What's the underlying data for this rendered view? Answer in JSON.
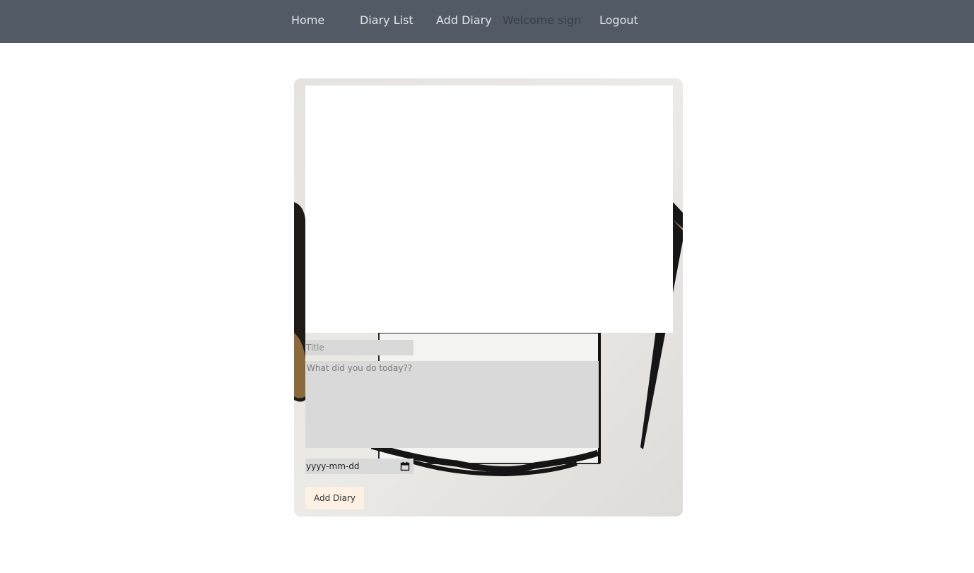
{
  "nav": {
    "home": "Home",
    "diary_list": "Diary List",
    "add_diary": "Add Diary",
    "welcome": "Welcome sign",
    "logout": "Logout"
  },
  "form": {
    "title_placeholder": "Title",
    "content_placeholder": "What did you do today??",
    "date_placeholder": "yyyy-mm-dd",
    "submit_label": "Add Diary"
  },
  "icons": {
    "date_picker": "calendar-icon"
  },
  "colors": {
    "navbar": "#525b65",
    "nav_text": "#e3e6e9",
    "welcome_text": "#383e45",
    "field_bg": "#d9d9d9",
    "button_bg": "#fcf1e3"
  }
}
